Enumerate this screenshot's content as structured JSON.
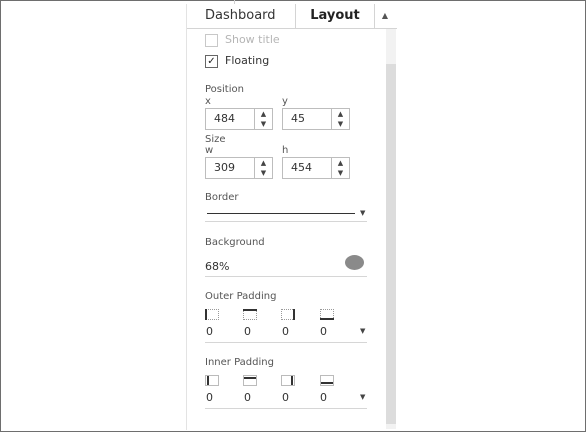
{
  "tabs": {
    "dashboard": "Dashboard",
    "layout": "Layout",
    "menu_icon": "up-down-arrows-icon"
  },
  "show_title": {
    "label": "Show title",
    "checked": false,
    "enabled": false
  },
  "floating": {
    "label": "Floating",
    "checked": true
  },
  "position": {
    "heading": "Position",
    "x_label": "x",
    "x_value": "484",
    "y_label": "y",
    "y_value": "45"
  },
  "size": {
    "heading": "Size",
    "w_label": "w",
    "w_value": "309",
    "h_label": "h",
    "h_value": "454"
  },
  "border": {
    "heading": "Border"
  },
  "background": {
    "heading": "Background",
    "opacity": "68%",
    "color": "#8a8a8a"
  },
  "outer_padding": {
    "heading": "Outer Padding",
    "values": [
      "0",
      "0",
      "0",
      "0"
    ]
  },
  "inner_padding": {
    "heading": "Inner Padding",
    "values": [
      "0",
      "0",
      "0",
      "0"
    ]
  }
}
